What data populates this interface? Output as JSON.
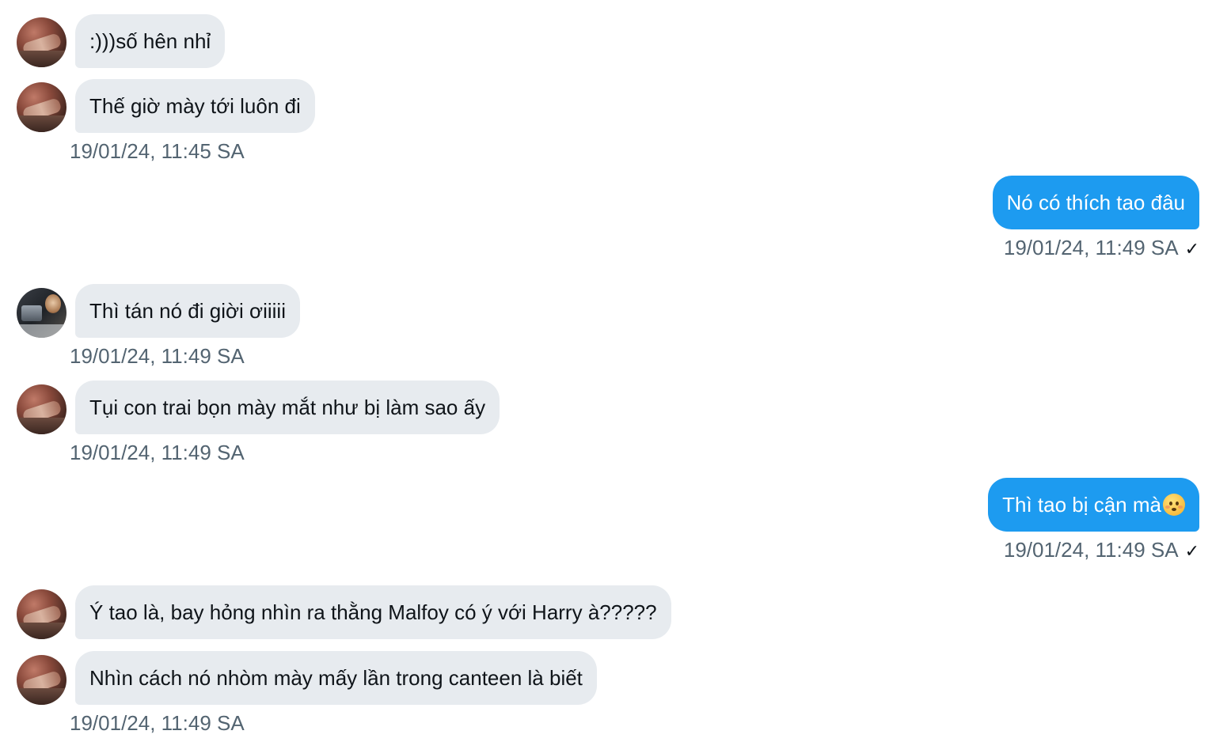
{
  "conversation": {
    "messages": [
      {
        "side": "in",
        "avatar": "avatar-a",
        "text": ":)))số hên nhỉ"
      },
      {
        "side": "in",
        "avatar": "avatar-a",
        "text": "Thế giờ mày tới luôn đi",
        "timestamp": "19/01/24, 11:45 SA"
      },
      {
        "side": "out",
        "text": "Nó có thích tao đâu",
        "timestamp": "19/01/24, 11:49 SA",
        "status": "✓"
      },
      {
        "side": "in",
        "avatar": "avatar-b",
        "text": "Thì tán nó đi giời ơiiiii",
        "timestamp": "19/01/24, 11:49 SA"
      },
      {
        "side": "in",
        "avatar": "avatar-a",
        "text": "Tụi con trai bọn mày mắt như bị làm sao ấy",
        "timestamp": "19/01/24, 11:49 SA"
      },
      {
        "side": "out",
        "text": "Thì tao bị cận mà",
        "emoji": "flushed-face-emoji",
        "timestamp": "19/01/24, 11:49 SA",
        "status": "✓"
      },
      {
        "side": "in",
        "avatar": "avatar-a",
        "text": "Ý tao là, bay hỏng nhìn ra thằng Malfoy có ý với Harry à?????"
      },
      {
        "side": "in",
        "avatar": "avatar-a",
        "text": "Nhìn cách nó nhòm mày mấy lần trong canteen là biết",
        "timestamp": "19/01/24, 11:49 SA"
      }
    ]
  },
  "colors": {
    "incoming_bubble": "#e7ebef",
    "outgoing_bubble": "#1d9bf0",
    "timestamp": "#536471"
  }
}
